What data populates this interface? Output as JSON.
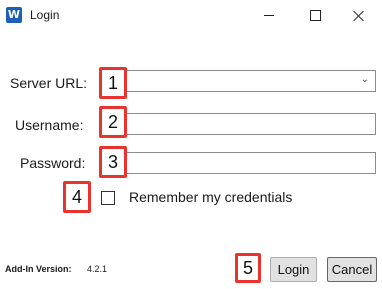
{
  "window": {
    "title": "Login",
    "app_icon_letter": "W",
    "app_icon": "word-icon",
    "controls": {
      "minimize": "minimize-icon",
      "maximize": "maximize-icon",
      "close": "close-icon"
    }
  },
  "form": {
    "server_url": {
      "label": "Server URL:",
      "value": "",
      "placeholder": "",
      "dropdown_icon": "⌄"
    },
    "username": {
      "label": "Username:",
      "value": "",
      "placeholder": ""
    },
    "password": {
      "label": "Password:",
      "value": "",
      "placeholder": ""
    },
    "remember": {
      "label": "Remember my credentials",
      "checked": false
    }
  },
  "annotations": [
    "1",
    "2",
    "3",
    "4",
    "5"
  ],
  "footer": {
    "version_label": "Add-In Version:",
    "version_value": "4.2.1",
    "login_label": "Login",
    "cancel_label": "Cancel"
  },
  "colors": {
    "annotation_border": "#e8332f",
    "app_icon": "#1b5fbd"
  }
}
